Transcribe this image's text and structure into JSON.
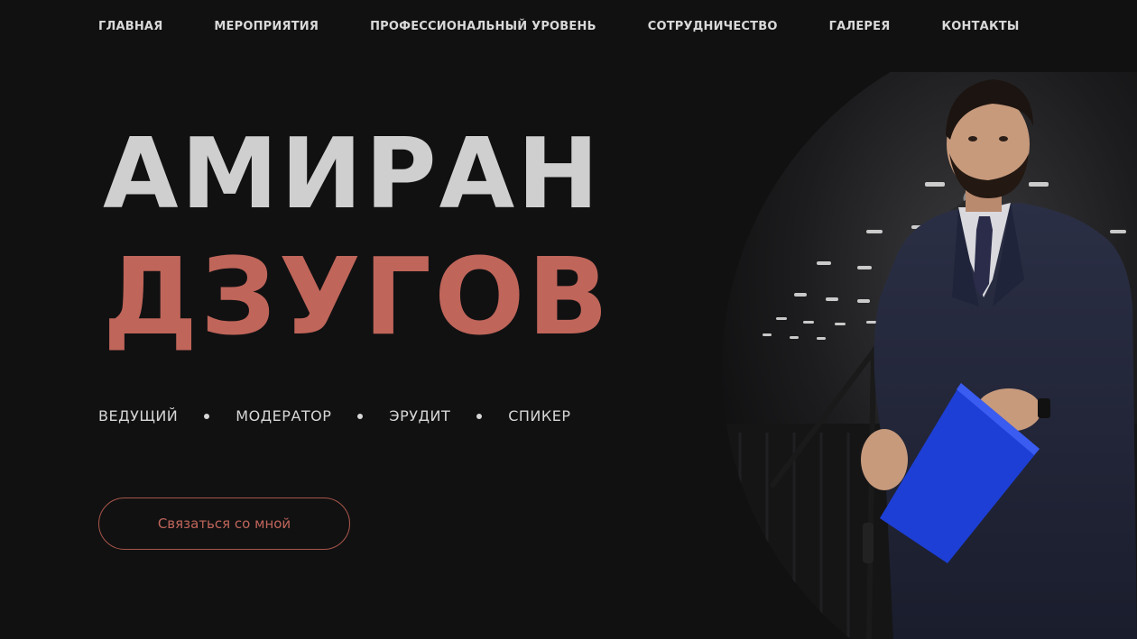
{
  "nav": {
    "items": [
      {
        "label": "ГЛАВНАЯ"
      },
      {
        "label": "МЕРОПРИЯТИЯ"
      },
      {
        "label": "ПРОФЕССИОНАЛЬНЫЙ УРОВЕНЬ"
      },
      {
        "label": "СОТРУДНИЧЕСТВО"
      },
      {
        "label": "ГАЛЕРЕЯ"
      },
      {
        "label": "КОНТАКТЫ"
      }
    ]
  },
  "hero": {
    "first_name": "АМИРАН",
    "last_name": "ДЗУГОВ",
    "roles": [
      "ВЕДУЩИЙ",
      "МОДЕРАТОР",
      "ЭРУДИТ",
      "СПИКЕР"
    ],
    "cta_label": "Связаться со мной"
  },
  "colors": {
    "background": "#111112",
    "accent": "#c0655a",
    "light_text": "#cfcfcf"
  }
}
